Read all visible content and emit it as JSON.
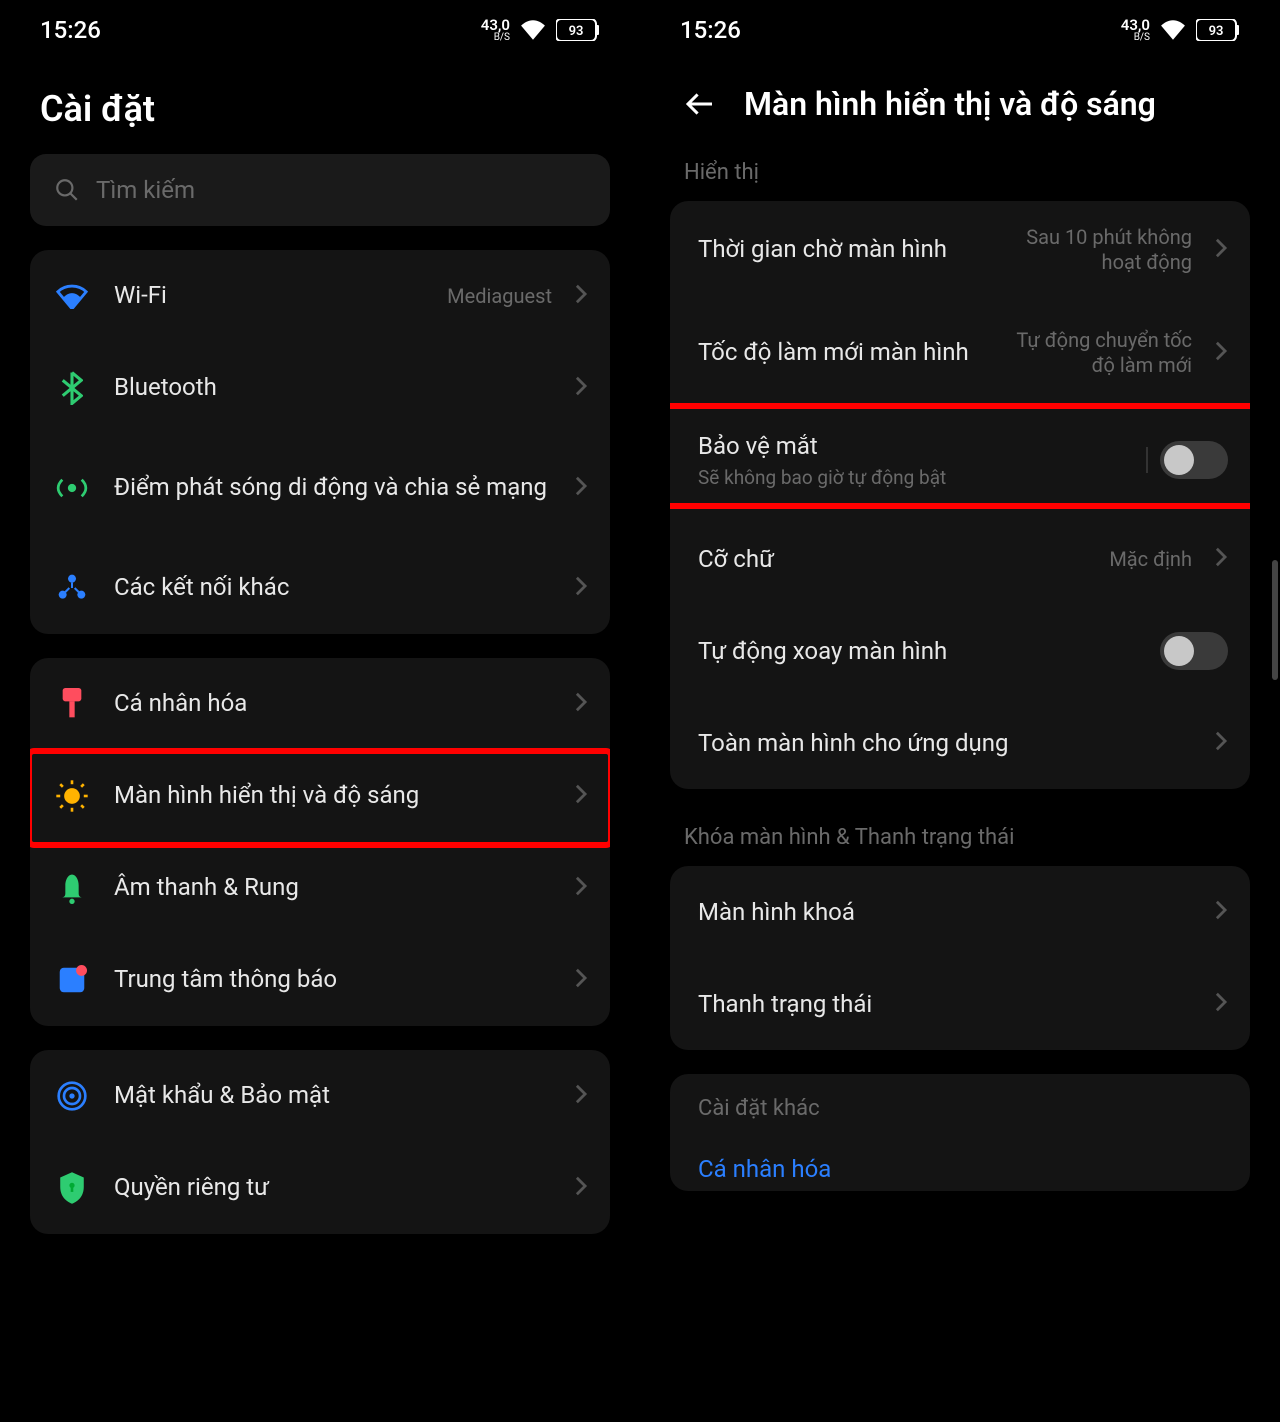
{
  "status": {
    "time": "15:26",
    "speed_top": "43,0",
    "speed_bot": "B/S",
    "battery": "93"
  },
  "left": {
    "title": "Cài đặt",
    "search_placeholder": "Tìm kiếm",
    "groups": [
      {
        "rows": [
          {
            "icon": "wifi",
            "label": "Wi-Fi",
            "value": "Mediaguest"
          },
          {
            "icon": "bluetooth",
            "label": "Bluetooth"
          },
          {
            "icon": "hotspot",
            "label": "Điểm phát sóng di động và chia sẻ mạng"
          },
          {
            "icon": "connections",
            "label": "Các kết nối khác"
          }
        ]
      },
      {
        "rows": [
          {
            "icon": "personalize",
            "label": "Cá nhân hóa"
          },
          {
            "icon": "display",
            "label": "Màn hình hiển thị và độ sáng",
            "highlight": true
          },
          {
            "icon": "sound",
            "label": "Âm thanh & Rung"
          },
          {
            "icon": "notification",
            "label": "Trung tâm thông báo"
          }
        ]
      },
      {
        "rows": [
          {
            "icon": "security",
            "label": "Mật khẩu & Bảo mật"
          },
          {
            "icon": "privacy",
            "label": "Quyền riêng tư"
          }
        ]
      }
    ]
  },
  "right": {
    "title": "Màn hình hiển thị và độ sáng",
    "sections": [
      {
        "header": "Hiển thị",
        "rows": [
          {
            "label": "Thời gian chờ màn hình",
            "value": "Sau 10 phút không hoạt động",
            "chevron": true
          },
          {
            "label": "Tốc độ làm mới màn hình",
            "value": "Tự động chuyển tốc độ làm mới",
            "chevron": true
          },
          {
            "label": "Bảo vệ mắt",
            "sublabel": "Sẽ không bao giờ tự động bật",
            "toggle": true,
            "toggle_bar": true,
            "highlight": true
          },
          {
            "label": "Cỡ chữ",
            "value": "Mặc định",
            "chevron": true
          },
          {
            "label": "Tự động xoay màn hình",
            "toggle": true
          },
          {
            "label": "Toàn màn hình cho ứng dụng",
            "chevron": true
          }
        ]
      },
      {
        "header": "Khóa màn hình & Thanh trạng thái",
        "rows": [
          {
            "label": "Màn hình khoá",
            "chevron": true
          },
          {
            "label": "Thanh trạng thái",
            "chevron": true
          }
        ]
      },
      {
        "header": "Cài đặt khác",
        "link": "Cá nhân hóa"
      }
    ]
  }
}
